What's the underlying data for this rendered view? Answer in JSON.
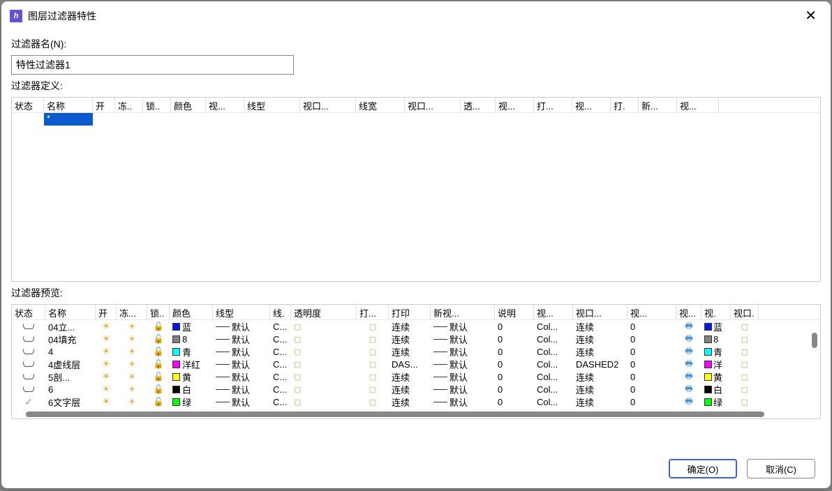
{
  "dialog": {
    "title": "图层过滤器特性",
    "filter_name_label": "过滤器名(N):",
    "filter_name_value": "特性过滤器1",
    "filter_def_label": "过滤器定义:",
    "filter_preview_label": "过滤器预览:"
  },
  "def_headers": [
    "状态",
    "名称",
    "开",
    "冻..",
    "锁..",
    "颜色",
    "视...",
    "线型",
    "视口...",
    "线宽",
    "视口...",
    "透...",
    "视...",
    "打...",
    "视...",
    "打.",
    "新...",
    "视..."
  ],
  "def_row_name": "*",
  "preview_headers": [
    "状态",
    "名称",
    "开",
    "冻...",
    "锁..",
    "颜色",
    "线型",
    "线.",
    "透明度",
    "打...",
    "打印",
    "新视...",
    "说明",
    "视...",
    "视口...",
    "视...",
    "视...",
    "视.",
    "视口."
  ],
  "colors": {
    "blue": "#0018f0",
    "gray8": "#808080",
    "cyan": "#00ffff",
    "magenta": "#ff00ff",
    "yellow": "#ffff00",
    "white": "#000000",
    "green": "#00ff00"
  },
  "rows": [
    {
      "state": "box",
      "name": "04立...",
      "on": true,
      "color": "blue",
      "color_label": "蓝",
      "linetype": "默认",
      "vp1": "C...",
      "trans": "0",
      "print": "连续",
      "new": "默认",
      "desc": "0",
      "vpc": "Col...",
      "vpl": "连续",
      "vpt": "0",
      "vpcol": "blue",
      "vpcol_label": "蓝"
    },
    {
      "state": "box",
      "name": "04填充",
      "on": true,
      "color": "gray8",
      "color_label": "8",
      "linetype": "默认",
      "vp1": "C...",
      "trans": "0",
      "print": "连续",
      "new": "默认",
      "desc": "0",
      "vpc": "Col...",
      "vpl": "连续",
      "vpt": "0",
      "vpcol": "gray8",
      "vpcol_label": "8"
    },
    {
      "state": "box",
      "name": "4",
      "on": true,
      "color": "cyan",
      "color_label": "青",
      "linetype": "默认",
      "vp1": "C...",
      "trans": "0",
      "print": "连续",
      "new": "默认",
      "desc": "0",
      "vpc": "Col...",
      "vpl": "连续",
      "vpt": "0",
      "vpcol": "cyan",
      "vpcol_label": "青"
    },
    {
      "state": "box",
      "name": "4虚线层",
      "on": true,
      "color": "magenta",
      "color_label": "洋红",
      "linetype": "默认",
      "vp1": "C...",
      "trans": "0",
      "print": "DAS...",
      "new": "默认",
      "desc": "0",
      "vpc": "Col...",
      "vpl": "DASHED2",
      "vpt": "0",
      "vpcol": "magenta",
      "vpcol_label": "洋"
    },
    {
      "state": "box",
      "name": "5剖...",
      "on": true,
      "color": "yellow",
      "color_label": "黄",
      "linetype": "默认",
      "vp1": "C...",
      "trans": "0",
      "print": "连续",
      "new": "默认",
      "desc": "0",
      "vpc": "Col...",
      "vpl": "连续",
      "vpt": "0",
      "vpcol": "yellow",
      "vpcol_label": "黄"
    },
    {
      "state": "box",
      "name": "6",
      "on": true,
      "color": "white",
      "color_label": "白",
      "linetype": "默认",
      "vp1": "C...",
      "trans": "0",
      "print": "连续",
      "new": "默认",
      "desc": "0",
      "vpc": "Col...",
      "vpl": "连续",
      "vpt": "0",
      "vpcol": "white",
      "vpcol_label": "白"
    },
    {
      "state": "check",
      "name": "6文字层",
      "on": true,
      "color": "green",
      "color_label": "绿",
      "linetype": "默认",
      "vp1": "C...",
      "trans": "0",
      "print": "连续",
      "new": "默认",
      "desc": "0",
      "vpc": "Col...",
      "vpl": "连续",
      "vpt": "0",
      "vpcol": "green",
      "vpcol_label": "绿"
    }
  ],
  "buttons": {
    "ok": "确定(O)",
    "cancel": "取消(C)"
  }
}
